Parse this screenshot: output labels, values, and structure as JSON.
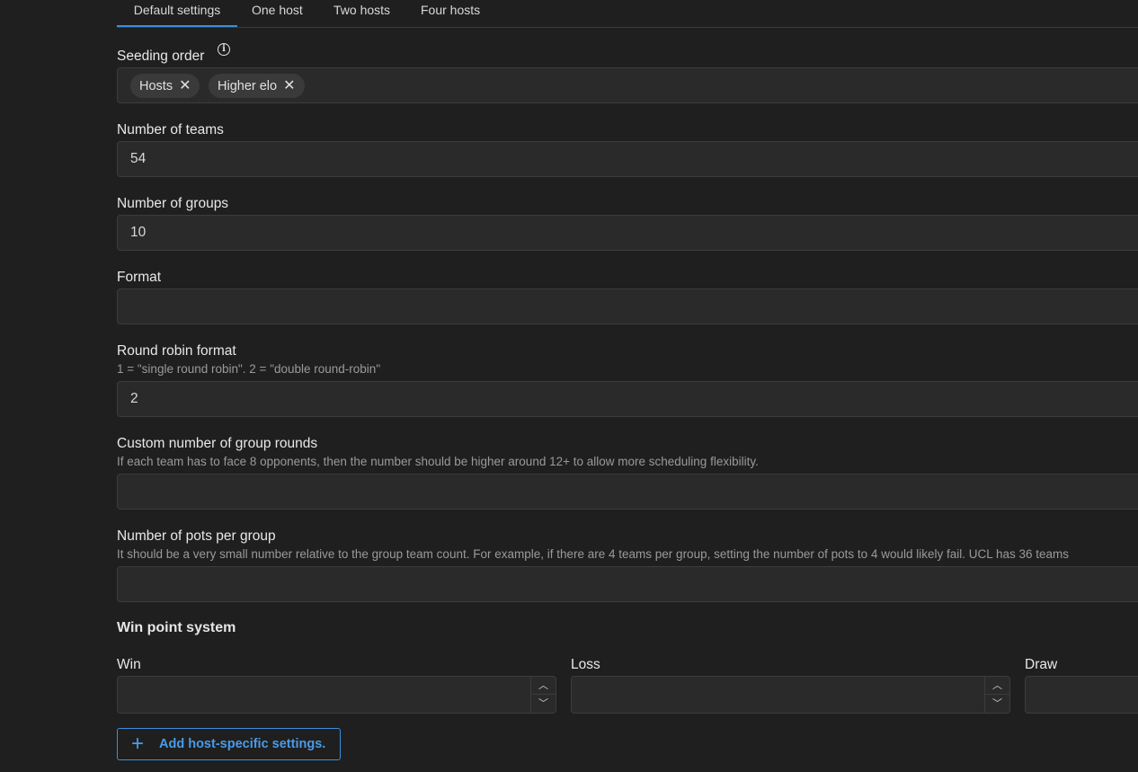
{
  "tabs": [
    {
      "label": "Default settings",
      "active": true
    },
    {
      "label": "One host"
    },
    {
      "label": "Two hosts"
    },
    {
      "label": "Four hosts"
    }
  ],
  "seeding_order": {
    "label": "Seeding order",
    "icon": "info-icon",
    "chips": [
      "Hosts",
      "Higher elo"
    ]
  },
  "number_of_teams": {
    "label": "Number of teams",
    "value": "54"
  },
  "number_of_groups": {
    "label": "Number of groups",
    "value": "10"
  },
  "format": {
    "label": "Format",
    "value": ""
  },
  "round_robin_format": {
    "label": "Round robin format",
    "description": "1 = \"single round robin\". 2 = \"double round-robin\"",
    "value": "2"
  },
  "custom_group_rounds": {
    "label": "Custom number of group rounds",
    "description": "If each team has to face 8 opponents, then the number should be higher around 12+ to allow more scheduling flexibility.",
    "value": ""
  },
  "pots_per_group": {
    "label": "Number of pots per group",
    "description": "It should be a very small number relative to the group team count. For example, if there are 4 teams per group, setting the number of pots to 4 would likely fail. UCL has 36 teams",
    "value": ""
  },
  "win_point_system": {
    "title": "Win point system",
    "win_label": "Win",
    "loss_label": "Loss",
    "draw_label": "Draw"
  },
  "add_button": {
    "label": "Add host-specific settings.",
    "accent": "#3b8ede"
  }
}
